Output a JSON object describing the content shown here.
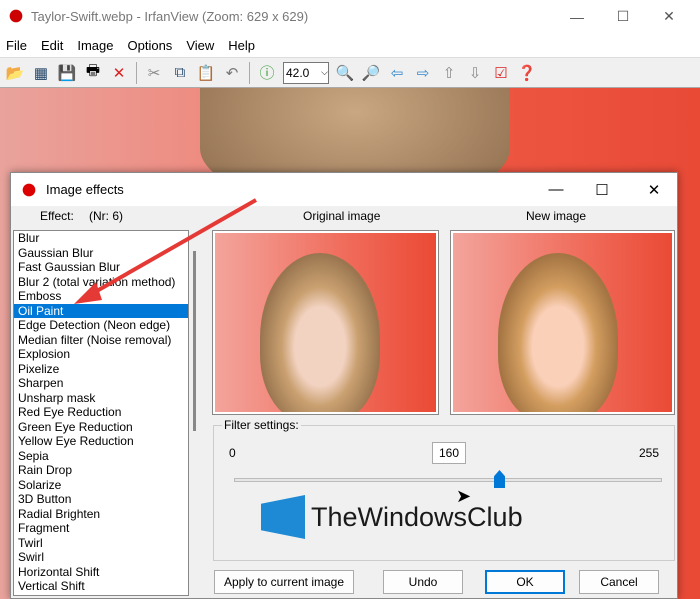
{
  "window": {
    "title": "Taylor-Swift.webp - IrfanView (Zoom: 629 x 629)",
    "min": "—",
    "max": "☐",
    "close": "✕"
  },
  "menu": [
    "File",
    "Edit",
    "Image",
    "Options",
    "View",
    "Help"
  ],
  "toolbar": {
    "zoom_value": "42.0"
  },
  "dialog": {
    "title": "Image effects",
    "effect_label": "Effect:",
    "effect_nr": "(Nr: 6)",
    "original_label": "Original image",
    "new_label": "New image",
    "effects": [
      "Blur",
      "Gaussian Blur",
      "Fast Gaussian Blur",
      "Blur 2 (total variation method)",
      "Emboss",
      "Oil Paint",
      "Edge Detection (Neon edge)",
      "Median filter (Noise removal)",
      "Explosion",
      "Pixelize",
      "Sharpen",
      "Unsharp mask",
      "Red Eye Reduction",
      "Green Eye Reduction",
      "Yellow Eye Reduction",
      "Sepia",
      "Rain Drop",
      "Solarize",
      "3D Button",
      "Radial Brighten",
      "Fragment",
      "Twirl",
      "Swirl",
      "Horizontal Shift",
      "Vertical Shift"
    ],
    "selected_index": 5,
    "filter": {
      "label": "Filter settings:",
      "min": "0",
      "max": "255",
      "value": "160"
    },
    "buttons": {
      "apply": "Apply to current image",
      "undo": "Undo",
      "ok": "OK",
      "cancel": "Cancel"
    }
  },
  "watermark": "TheWindowsClub"
}
